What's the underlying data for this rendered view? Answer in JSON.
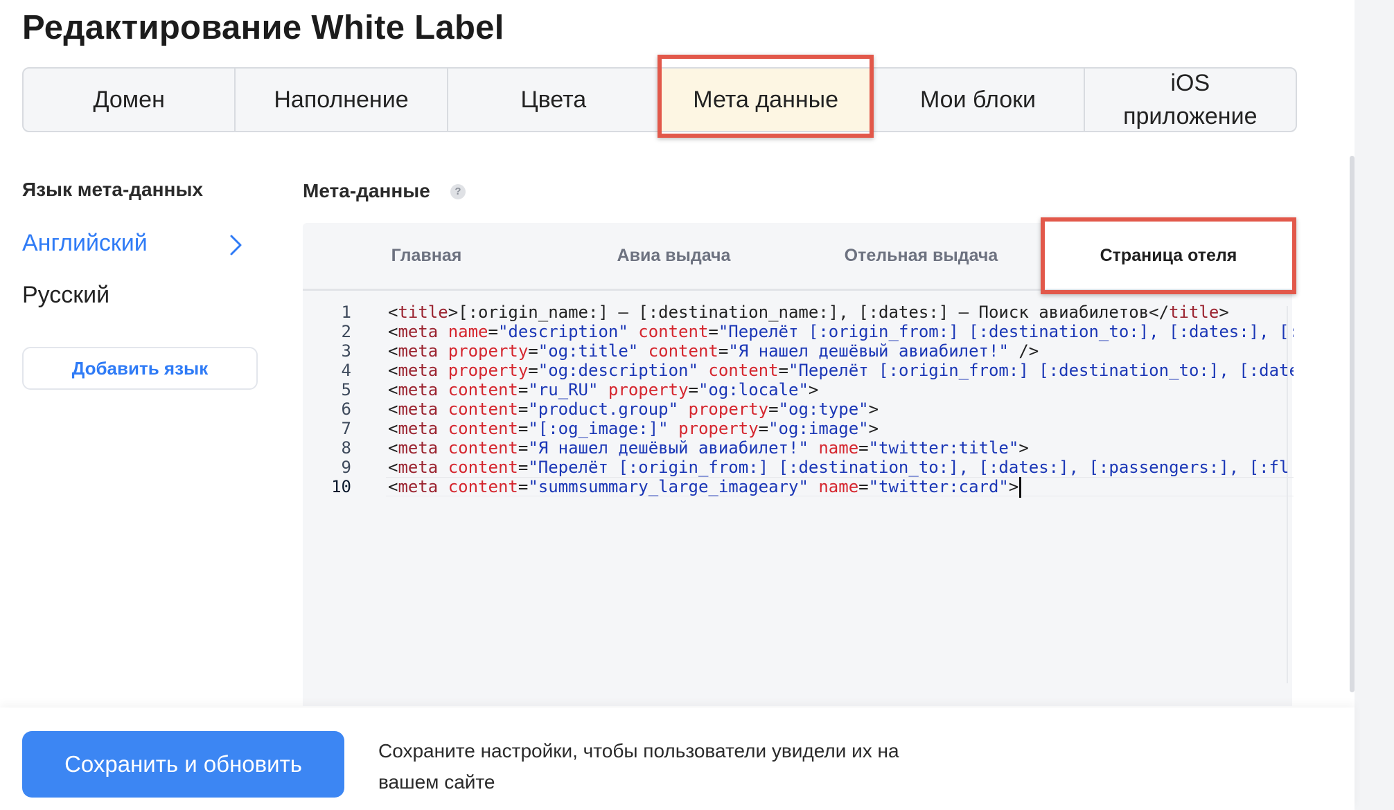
{
  "page": {
    "title": "Редактирование White Label"
  },
  "main_tabs": [
    {
      "label": "Домен",
      "active": false
    },
    {
      "label": "Наполнение",
      "active": false
    },
    {
      "label": "Цвета",
      "active": false
    },
    {
      "label": "Мета данные",
      "active": true
    },
    {
      "label": "Мои блоки",
      "active": false
    },
    {
      "label": "iOS приложение",
      "active": false
    }
  ],
  "sidebar": {
    "heading": "Язык мета-данных",
    "languages": [
      {
        "label": "Английский",
        "selected": true,
        "icon": "chevron-right-icon"
      },
      {
        "label": "Русский",
        "selected": false
      }
    ],
    "add_button_label": "Добавить язык"
  },
  "meta": {
    "heading": "Мета-данные",
    "help_icon": "?",
    "sub_tabs": [
      {
        "label": "Главная",
        "active": false
      },
      {
        "label": "Авиа выдача",
        "active": false
      },
      {
        "label": "Отельная выдача",
        "active": false
      },
      {
        "label": "Страница отеля",
        "active": true
      }
    ],
    "code_lines": [
      {
        "no": "1",
        "text": "<title>[:origin_name:] – [:destination_name:], [:dates:] – Поиск авиабилетов</title>"
      },
      {
        "no": "2",
        "text": "<meta name=\"description\" content=\"Перелёт [:origin_from:] [:destination_to:], [:dates:], [:"
      },
      {
        "no": "3",
        "text": "<meta property=\"og:title\" content=\"Я нашел дешёвый авиабилет!\" />"
      },
      {
        "no": "4",
        "text": "<meta property=\"og:description\" content=\"Перелёт [:origin_from:] [:destination_to:], [:date"
      },
      {
        "no": "5",
        "text": "<meta content=\"ru_RU\" property=\"og:locale\">"
      },
      {
        "no": "6",
        "text": "<meta content=\"product.group\" property=\"og:type\">"
      },
      {
        "no": "7",
        "text": "<meta content=\"[:og_image:]\" property=\"og:image\">"
      },
      {
        "no": "8",
        "text": "<meta content=\"Я нашел дешёвый авиабилет!\" name=\"twitter:title\">"
      },
      {
        "no": "9",
        "text": "<meta content=\"Перелёт [:origin_from:] [:destination_to:], [:dates:], [:passengers:], [:fl"
      },
      {
        "no": "10",
        "text": "<meta content=\"summsummary_large_imageary\" name=\"twitter:card\">"
      }
    ],
    "current_line": "10"
  },
  "footer": {
    "save_button_label": "Сохранить и обновить",
    "hint": "Сохраните настройки, чтобы пользователи увидели их на вашем сайте"
  },
  "colors": {
    "accent_blue": "#3c86f3",
    "highlight_red": "#e2584a",
    "active_tab_bg": "#fdf6e3"
  }
}
